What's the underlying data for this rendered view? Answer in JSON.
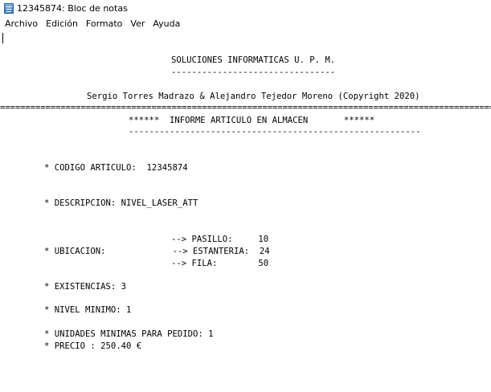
{
  "window": {
    "title": "12345874: Bloc de notas",
    "icon": "notepad-icon"
  },
  "menu": [
    "Archivo",
    "Edición",
    "Formato",
    "Ver",
    "Ayuda"
  ],
  "document": {
    "company": "SOLUCIONES INFORMATICAS U. P. M.",
    "company_underline": "--------------------------------",
    "authors": "Sergio Torres Madrazo & Alejandro Tejedor Moreno (Copyright 2020)",
    "separator": "==================================================================================================",
    "report_title": "******  INFORME ARTICULO EN ALMACEN       ******",
    "report_underline": "---------------------------------------------------------",
    "codigo_line": "* CODIGO ARTICULO:  12345874",
    "descripcion_line": "* DESCRIPCION: NIVEL_LASER_ATT",
    "pasillo_line": "--> PASILLO:     10",
    "ubicacion_line": "* UBICACION:             --> ESTANTERIA:  24",
    "fila_line": "--> FILA:        50",
    "existencias_line": "* EXISTENCIAS: 3",
    "nivel_line": "* NIVEL MINIMO: 1",
    "unidades_line": "* UNIDADES MINIMAS PARA PEDIDO: 1",
    "precio_line": "* PRECIO : 250.40 €"
  }
}
